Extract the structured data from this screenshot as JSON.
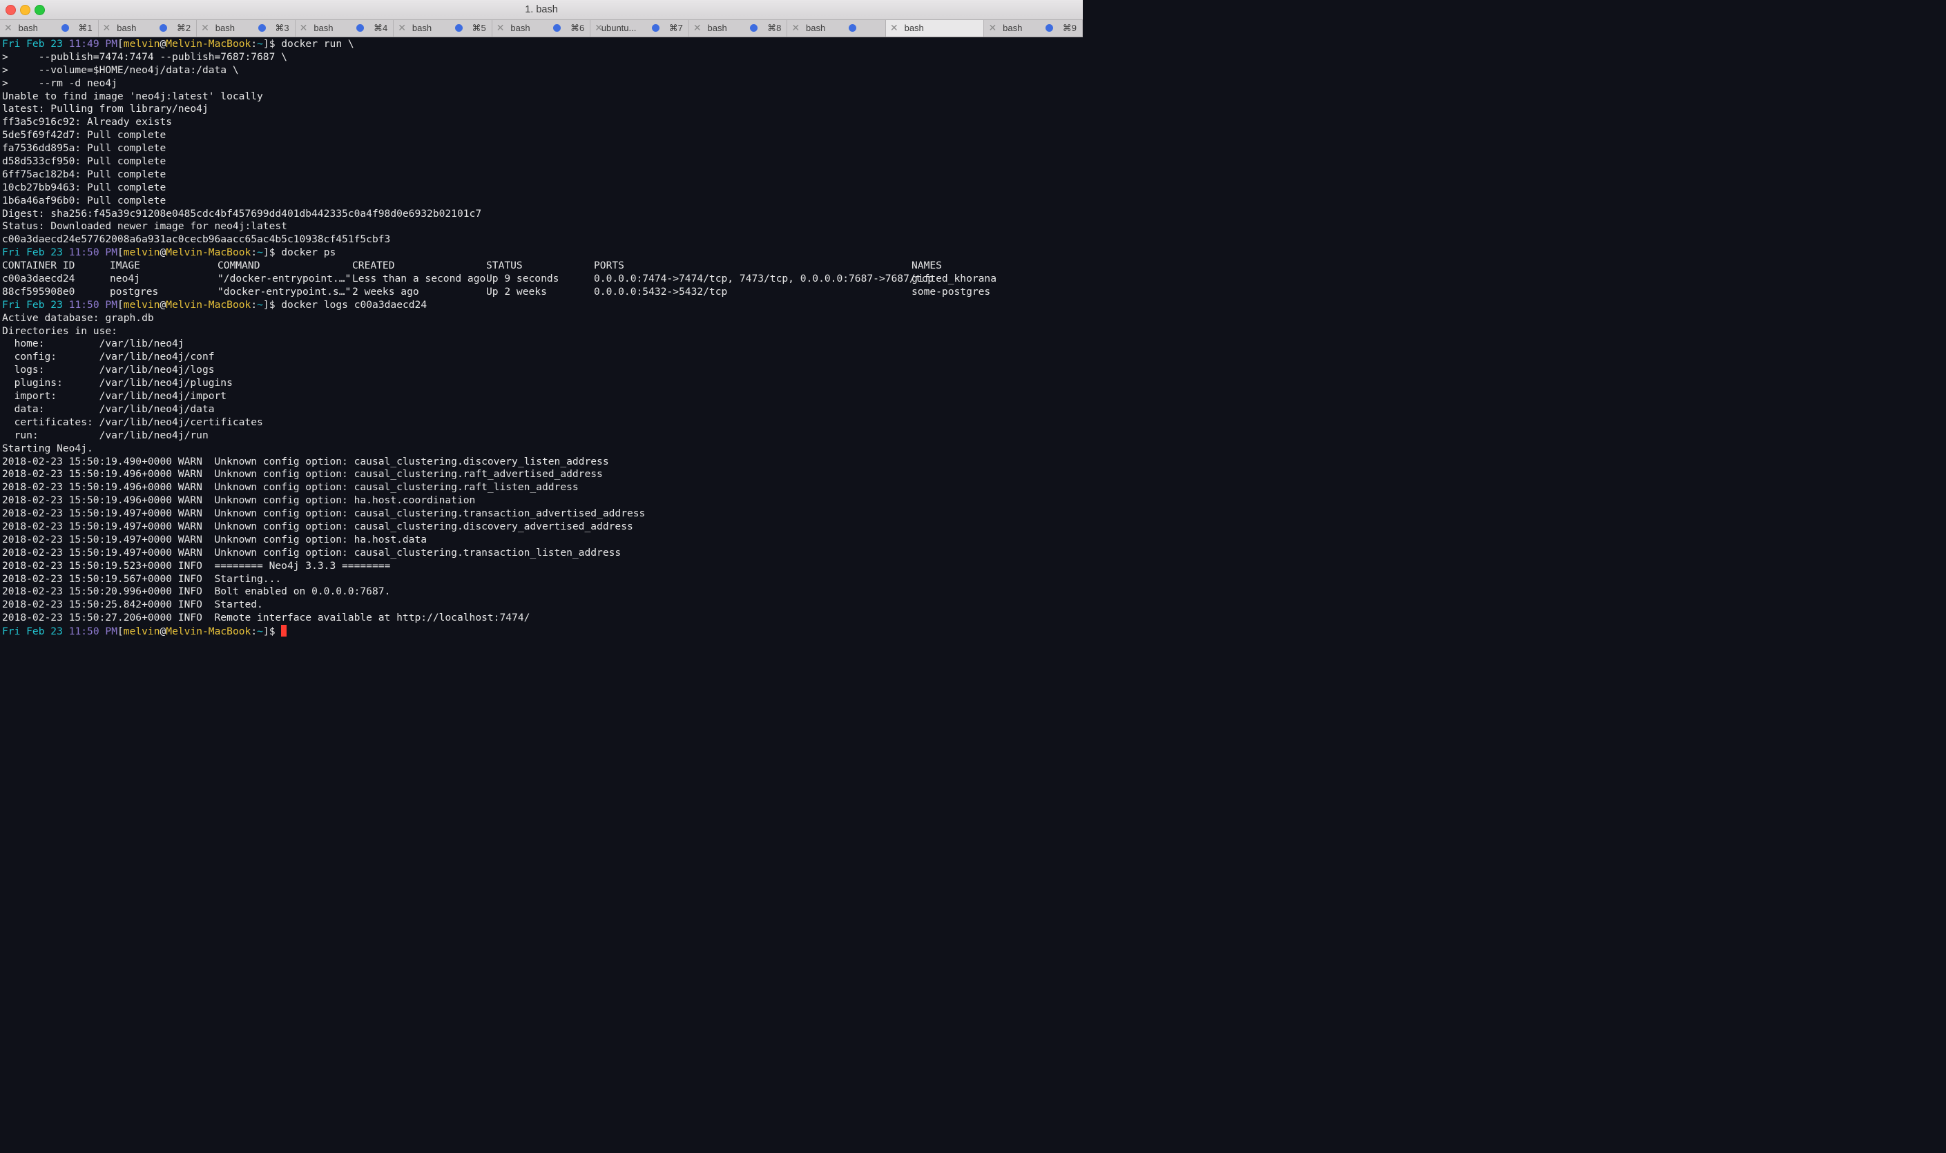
{
  "window": {
    "title": "1. bash"
  },
  "tabs": [
    {
      "label": "bash",
      "key": "⌘1",
      "active": false
    },
    {
      "label": "bash",
      "key": "⌘2",
      "active": false
    },
    {
      "label": "bash",
      "key": "⌘3",
      "active": false
    },
    {
      "label": "bash",
      "key": "⌘4",
      "active": false
    },
    {
      "label": "bash",
      "key": "⌘5",
      "active": false
    },
    {
      "label": "bash",
      "key": "⌘6",
      "active": false
    },
    {
      "label": "ubuntu...",
      "key": "⌘7",
      "active": false
    },
    {
      "label": "bash",
      "key": "⌘8",
      "active": false
    },
    {
      "label": "bash",
      "key": "",
      "active": false
    },
    {
      "label": "bash",
      "key": "",
      "active": true
    },
    {
      "label": "bash",
      "key": "⌘9",
      "active": false
    }
  ],
  "prompt": {
    "day": "Fri Feb 23",
    "ampm": "PM",
    "user": "melvin",
    "at": "@",
    "host": "Melvin-MacBook",
    "path": "~"
  },
  "prompt_times": [
    "11:49",
    "11:50",
    "11:50",
    "11:50"
  ],
  "commands": [
    "docker run \\",
    "docker ps",
    "docker logs c00a3daecd24",
    ""
  ],
  "block1": [
    ">     --publish=7474:7474 --publish=7687:7687 \\",
    ">     --volume=$HOME/neo4j/data:/data \\",
    ">     --rm -d neo4j",
    "Unable to find image 'neo4j:latest' locally",
    "latest: Pulling from library/neo4j",
    "ff3a5c916c92: Already exists",
    "5de5f69f42d7: Pull complete",
    "fa7536dd895a: Pull complete",
    "d58d533cf950: Pull complete",
    "6ff75ac182b4: Pull complete",
    "10cb27bb9463: Pull complete",
    "1b6a46af96b0: Pull complete",
    "Digest: sha256:f45a39c91208e0485cdc4bf457699dd401db442335c0a4f98d0e6932b02101c7",
    "Status: Downloaded newer image for neo4j:latest",
    "c00a3daecd24e57762008a6a931ac0cecb96aacc65ac4b5c10938cf451f5cbf3"
  ],
  "ps": {
    "headers": [
      "CONTAINER ID",
      "IMAGE",
      "COMMAND",
      "CREATED",
      "STATUS",
      "PORTS",
      "NAMES"
    ],
    "rows": [
      [
        "c00a3daecd24",
        "neo4j",
        "\"/docker-entrypoint.…\"",
        "Less than a second ago",
        "Up 9 seconds",
        "0.0.0.0:7474->7474/tcp, 7473/tcp, 0.0.0.0:7687->7687/tcp",
        "gifted_khorana"
      ],
      [
        "88cf595908e0",
        "postgres",
        "\"docker-entrypoint.s…\"",
        "2 weeks ago",
        "Up 2 weeks",
        "0.0.0.0:5432->5432/tcp",
        "some-postgres"
      ]
    ]
  },
  "logs": [
    "Active database: graph.db",
    "Directories in use:",
    "  home:         /var/lib/neo4j",
    "  config:       /var/lib/neo4j/conf",
    "  logs:         /var/lib/neo4j/logs",
    "  plugins:      /var/lib/neo4j/plugins",
    "  import:       /var/lib/neo4j/import",
    "  data:         /var/lib/neo4j/data",
    "  certificates: /var/lib/neo4j/certificates",
    "  run:          /var/lib/neo4j/run",
    "Starting Neo4j.",
    "2018-02-23 15:50:19.490+0000 WARN  Unknown config option: causal_clustering.discovery_listen_address",
    "2018-02-23 15:50:19.496+0000 WARN  Unknown config option: causal_clustering.raft_advertised_address",
    "2018-02-23 15:50:19.496+0000 WARN  Unknown config option: causal_clustering.raft_listen_address",
    "2018-02-23 15:50:19.496+0000 WARN  Unknown config option: ha.host.coordination",
    "2018-02-23 15:50:19.497+0000 WARN  Unknown config option: causal_clustering.transaction_advertised_address",
    "2018-02-23 15:50:19.497+0000 WARN  Unknown config option: causal_clustering.discovery_advertised_address",
    "2018-02-23 15:50:19.497+0000 WARN  Unknown config option: ha.host.data",
    "2018-02-23 15:50:19.497+0000 WARN  Unknown config option: causal_clustering.transaction_listen_address",
    "2018-02-23 15:50:19.523+0000 INFO  ======== Neo4j 3.3.3 ========",
    "2018-02-23 15:50:19.567+0000 INFO  Starting...",
    "2018-02-23 15:50:20.996+0000 INFO  Bolt enabled on 0.0.0.0:7687.",
    "2018-02-23 15:50:25.842+0000 INFO  Started.",
    "2018-02-23 15:50:27.206+0000 INFO  Remote interface available at http://localhost:7474/"
  ]
}
